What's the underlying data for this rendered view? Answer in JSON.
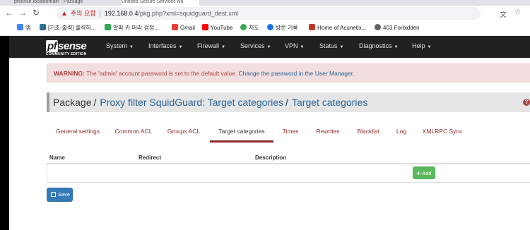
{
  "browser": {
    "tabs": [
      {
        "label": "pfsense.localdomain - Package"
      },
      {
        "label": "Untitled Secure Services No"
      }
    ],
    "security_label": "주의 요함",
    "url_host": "192.168.0.4",
    "url_path": "/pkg.php?xml=squidguard_dest.xml",
    "bookmarks": [
      {
        "label": "앱",
        "icon": "apps-icon",
        "color": "#4285f4"
      },
      {
        "label": "[기초-출력] 출력하...",
        "icon": "page-icon",
        "color": "#2f6f8f"
      },
      {
        "label": "알파 카 머리 검정...",
        "icon": "shop-icon",
        "color": "#2fa84f"
      },
      {
        "label": "Gmail",
        "icon": "gmail-icon",
        "color": "#ea4335"
      },
      {
        "label": "YouTube",
        "icon": "youtube-icon",
        "color": "#ff0000"
      },
      {
        "label": "지도",
        "icon": "maps-icon",
        "color": "#34a853"
      },
      {
        "label": "방문 기록",
        "icon": "history-icon",
        "color": "#1a73e8"
      },
      {
        "label": "Home of Acunetix...",
        "icon": "acunetix-icon",
        "color": "#c0392b"
      },
      {
        "label": "403 Forbidden",
        "icon": "globe-icon",
        "color": "#5f6368"
      }
    ]
  },
  "navbar": {
    "logo_text": "sense",
    "logo_prefix": "pf",
    "logo_edition": "COMMUNITY EDITION",
    "menu": [
      {
        "label": "System"
      },
      {
        "label": "Interfaces"
      },
      {
        "label": "Firewall"
      },
      {
        "label": "Services"
      },
      {
        "label": "VPN"
      },
      {
        "label": "Status"
      },
      {
        "label": "Diagnostics"
      },
      {
        "label": "Help"
      }
    ]
  },
  "alert": {
    "prefix": "WARNING:",
    "message": " The 'admin' account password is set to the default value. ",
    "link": "Change the password in the User Manager."
  },
  "breadcrumb": {
    "root": "Package",
    "item1": "Proxy filter SquidGuard: Target categories",
    "item2": "Target categories"
  },
  "tabs": [
    {
      "label": "General settings",
      "active": false
    },
    {
      "label": "Common ACL",
      "active": false
    },
    {
      "label": "Groups ACL",
      "active": false
    },
    {
      "label": "Target categories",
      "active": true
    },
    {
      "label": "Times",
      "active": false
    },
    {
      "label": "Rewrites",
      "active": false
    },
    {
      "label": "Blacklist",
      "active": false
    },
    {
      "label": "Log",
      "active": false
    },
    {
      "label": "XMLRPC Sync",
      "active": false
    }
  ],
  "table": {
    "columns": [
      "Name",
      "Redirect",
      "Description"
    ],
    "add_label": "Add"
  },
  "save_label": "Save",
  "colors": {
    "navbar": "#212121",
    "tab_active_underline": "#8b2b2b",
    "add_button": "#5cb85c",
    "save_button": "#337ab7",
    "alert_bg": "#f2dede"
  }
}
